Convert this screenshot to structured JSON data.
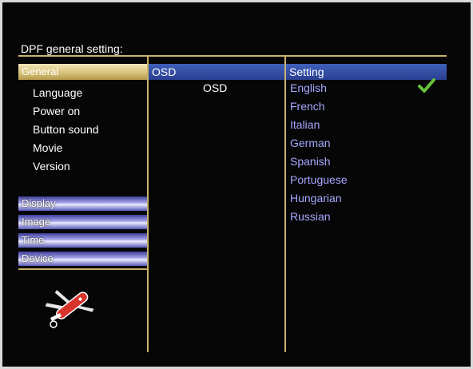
{
  "title": "DPF general setting:",
  "sidebar": {
    "active_tab": "General",
    "general_items": [
      "Language",
      "Power on",
      "Button sound",
      "Movie",
      "Version"
    ],
    "tabs": [
      "Display",
      "Image",
      "Time",
      "Device"
    ]
  },
  "middle": {
    "header": "OSD",
    "value": "OSD"
  },
  "right": {
    "header": "Setting",
    "languages": [
      "English",
      "French",
      "Italian",
      "German",
      "Spanish",
      "Portuguese",
      "Hungarian",
      "Russian"
    ],
    "selected": "English"
  },
  "colors": {
    "gold": "#c9b26c",
    "header_blue": "#2f4aa0",
    "option_text": "#a7a7ff",
    "check_green": "#66c23a"
  },
  "icons": {
    "selected_marker": "check-icon",
    "tool": "multitool-icon"
  }
}
